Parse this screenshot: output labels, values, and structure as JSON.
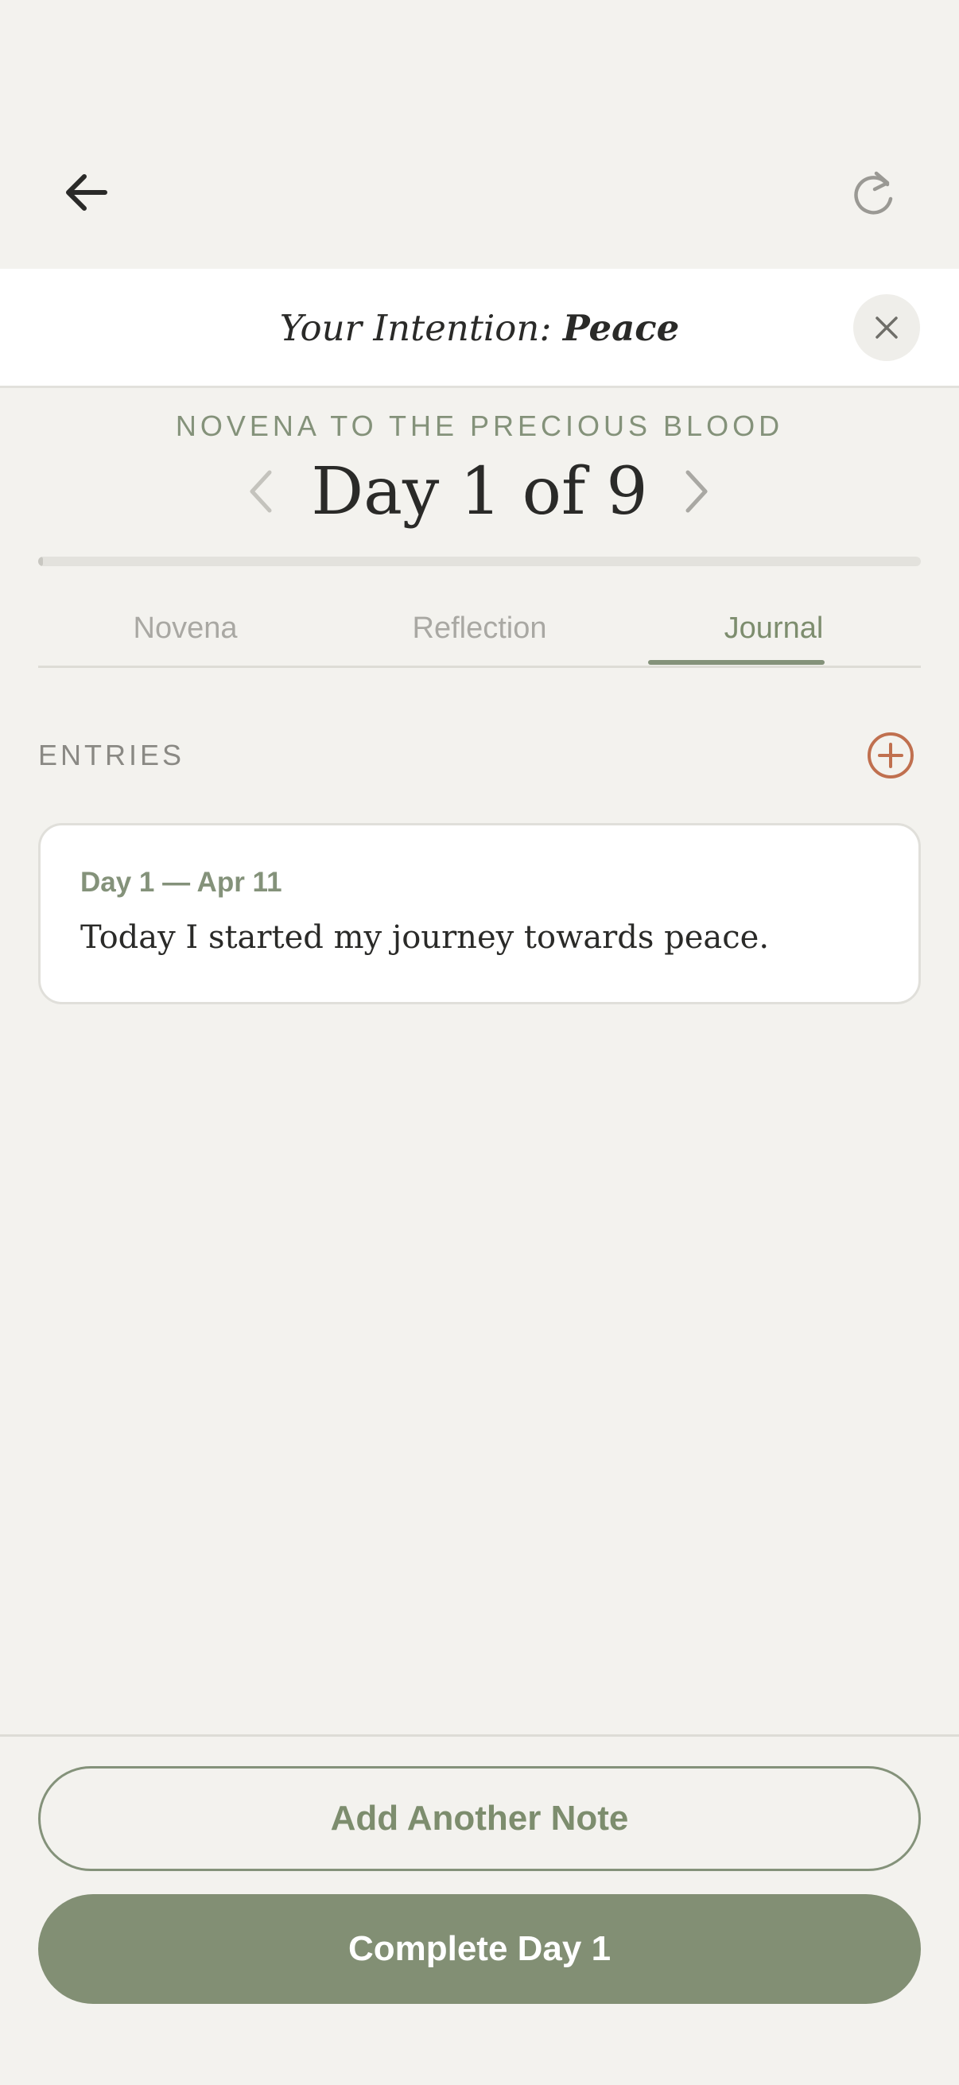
{
  "header": {
    "back_icon": "arrow-left-icon",
    "reset_icon": "refresh-icon"
  },
  "intention": {
    "label": "Your Intention:",
    "value": "Peace",
    "close_icon": "close-icon"
  },
  "novena": {
    "title": "NOVENA TO THE PRECIOUS BLOOD",
    "day_heading": "Day 1 of 9",
    "prev_icon": "chevron-left-icon",
    "next_icon": "chevron-right-icon",
    "progress_fraction": 0.005
  },
  "tabs": [
    {
      "label": "Novena",
      "active": false
    },
    {
      "label": "Reflection",
      "active": false
    },
    {
      "label": "Journal",
      "active": true
    }
  ],
  "journal": {
    "section_label": "ENTRIES",
    "add_icon": "plus-circle-icon",
    "entries": [
      {
        "date": "Day 1 — Apr 11",
        "text": "Today I started my journey towards peace."
      }
    ]
  },
  "footer": {
    "add_note_label": "Add Another Note",
    "complete_label": "Complete Day 1"
  },
  "colors": {
    "background": "#f3f2ee",
    "accent_green": "#84927a",
    "button_green": "#828f74",
    "add_icon_orange": "#c0704f",
    "text_dark": "#2a2a28"
  }
}
